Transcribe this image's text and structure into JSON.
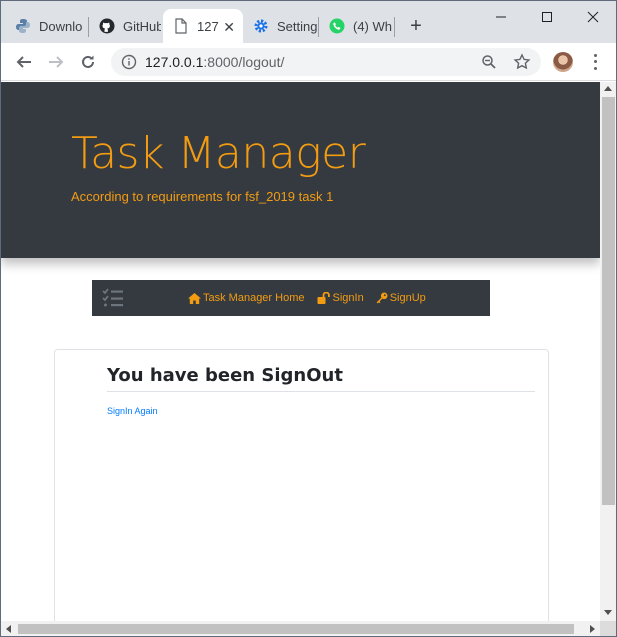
{
  "browser": {
    "tabs": [
      {
        "label": "Downlo",
        "icon": "python-logo-icon"
      },
      {
        "label": "GitHub",
        "icon": "github-icon"
      },
      {
        "label": "127",
        "icon": "page-icon",
        "active": true
      },
      {
        "label": "Setting",
        "icon": "gear-icon"
      },
      {
        "label": "(4) Wh",
        "icon": "whatsapp-icon"
      }
    ],
    "url_host": "127.0.0.1",
    "url_rest": ":8000/logout/"
  },
  "hero": {
    "title": "Task Manager",
    "subtitle": "According to requirements for fsf_2019 task 1"
  },
  "navbar": {
    "home_label": "Task Manager Home",
    "signin_label": "SignIn",
    "signup_label": "SignUp"
  },
  "card": {
    "heading": "You have been SignOut",
    "link_label": "SignIn Again"
  },
  "colors": {
    "accent": "#f39c12",
    "dark": "#343a40",
    "link": "#007bff"
  }
}
